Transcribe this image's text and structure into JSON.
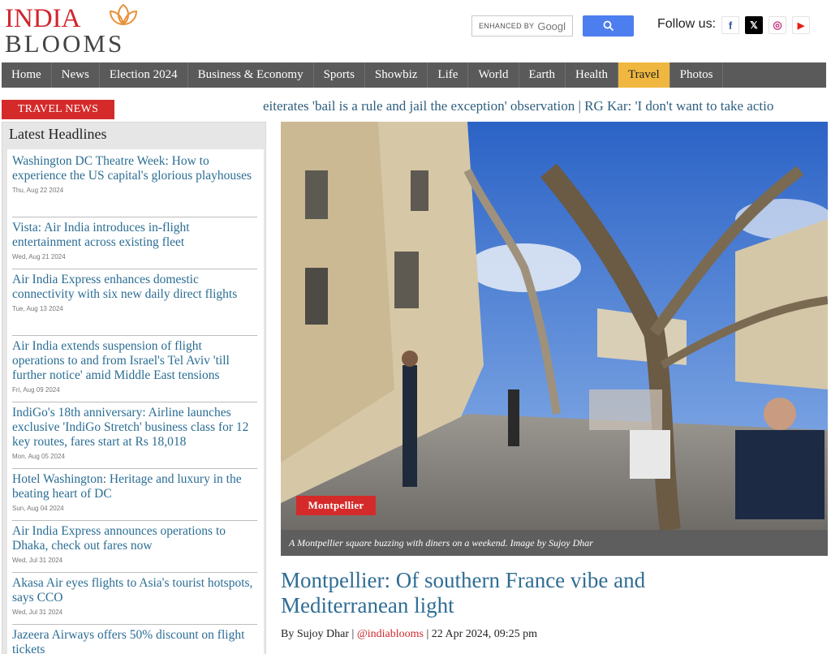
{
  "logo": {
    "top": "INDIA",
    "bottom": "BLOOMS"
  },
  "search": {
    "enhanced": "ENHANCED BY",
    "placeholder": "Googl"
  },
  "follow_label": "Follow us:",
  "social": [
    {
      "name": "facebook-icon",
      "glyph": "f",
      "color": "#3b5998"
    },
    {
      "name": "x-icon",
      "glyph": "𝕏",
      "color": "#000000"
    },
    {
      "name": "instagram-icon",
      "glyph": "◎",
      "color": "#c13584"
    },
    {
      "name": "youtube-icon",
      "glyph": "▶",
      "color": "#e62117"
    }
  ],
  "nav": {
    "items": [
      "Home",
      "News",
      "Election 2024",
      "Business & Economy",
      "Sports",
      "Showbiz",
      "Life",
      "World",
      "Earth",
      "Health",
      "Travel",
      "Photos"
    ],
    "active": "Travel"
  },
  "ticker": {
    "label": "TRAVEL NEWS",
    "text": "eiterates 'bail is a rule and jail the exception' observation | RG Kar: 'I don't want to take actio"
  },
  "sidebar": {
    "title": "Latest Headlines",
    "headlines": [
      {
        "title": "Washington DC Theatre Week: How to experience the US capital's glorious playhouses",
        "date": "Thu, Aug 22 2024"
      },
      {
        "title": "Vista: Air India introduces in-flight entertainment across existing fleet",
        "date": "Wed, Aug 21 2024"
      },
      {
        "title": "Air India Express enhances domestic connectivity with six new daily direct flights",
        "date": "Tue, Aug 13 2024"
      },
      {
        "title": "Air India extends suspension of flight operations to and from Israel's Tel Aviv 'till further notice' amid Middle East tensions",
        "date": "Fri, Aug 09 2024"
      },
      {
        "title": "IndiGo's 18th anniversary: Airline launches exclusive 'IndiGo Stretch' business class for 12 key routes, fares start at Rs 18,018",
        "date": "Mon, Aug 05 2024"
      },
      {
        "title": "Hotel Washington: Heritage and luxury in the beating heart of DC",
        "date": "Sun, Aug 04 2024"
      },
      {
        "title": "Air India Express announces operations to Dhaka, check out fares now",
        "date": "Wed, Jul 31 2024"
      },
      {
        "title": "Akasa Air eyes flights to Asia's tourist hotspots, says CCO",
        "date": "Wed, Jul 31 2024"
      },
      {
        "title": "Jazeera Airways offers 50% discount on flight tickets",
        "date": ""
      }
    ]
  },
  "article": {
    "badge": "Montpellier",
    "caption": "A Montpellier square buzzing with diners on a weekend. Image by Sujoy Dhar",
    "headline": "Montpellier: Of southern France vibe and Mediterranean light",
    "byline_prefix": "By Sujoy Dhar |",
    "handle": "@indiablooms",
    "byline_suffix": "| 22 Apr 2024, 09:25 pm"
  }
}
